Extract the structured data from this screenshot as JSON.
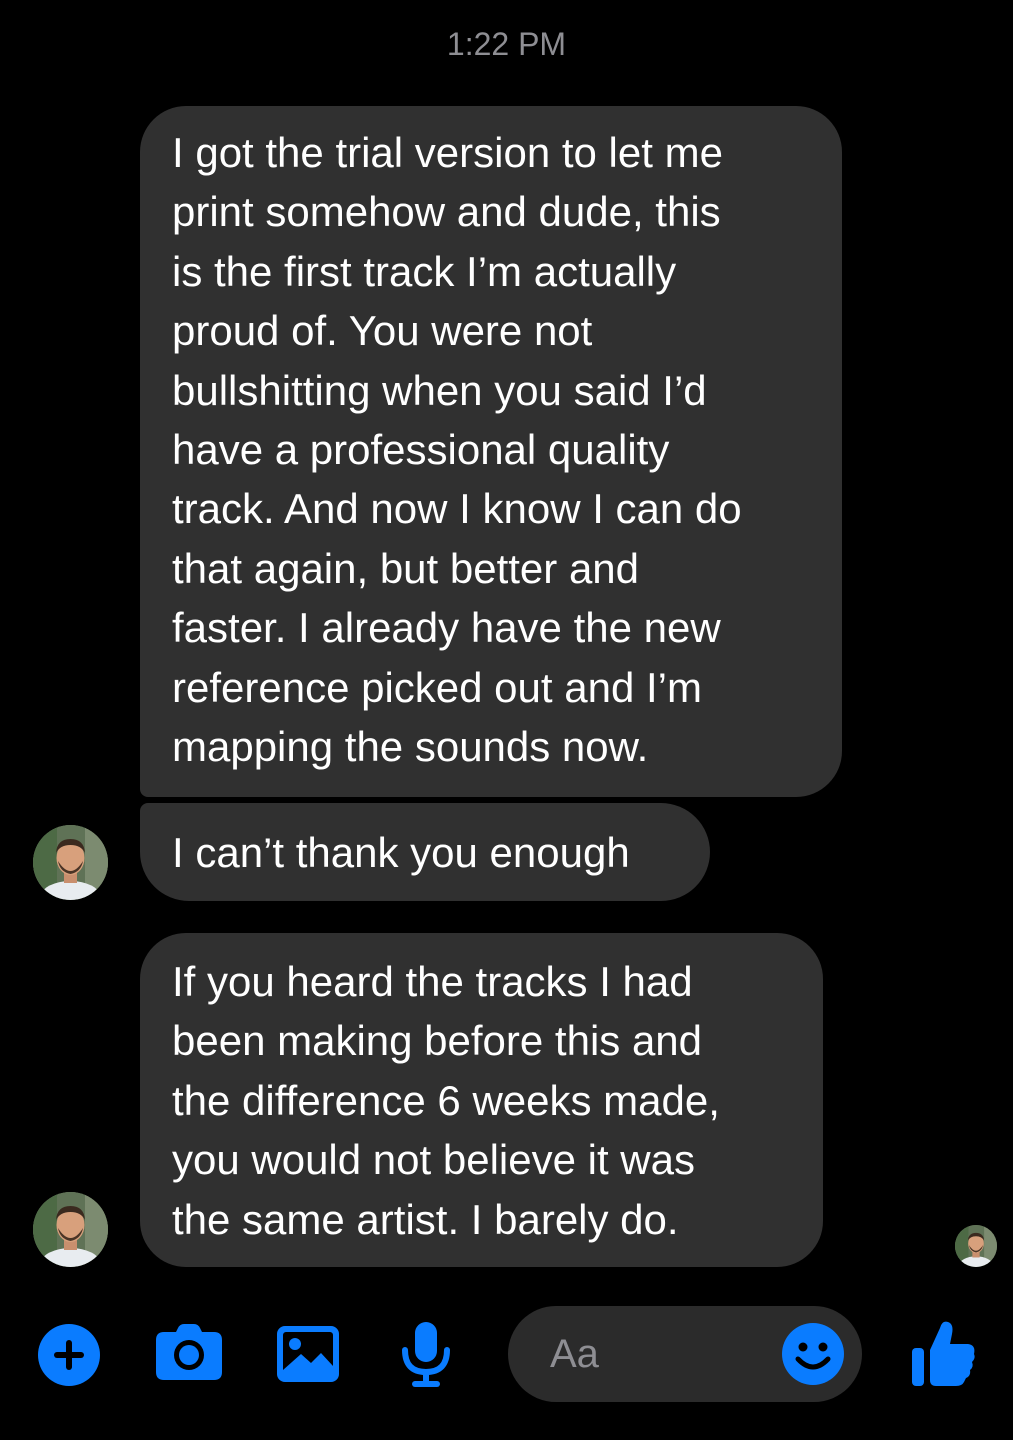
{
  "status": {
    "time": "1:22 PM"
  },
  "messages": [
    {
      "text": "I got the trial version to let me\nprint somehow and dude, this\nis the first track I’m actually\nproud of. You were not\nbullshitting when you said I’d\nhave a professional quality\ntrack. And now I know I can do\nthat again, but better and\nfaster. I already have the new\nreference picked out and I’m\nmapping the sounds now."
    },
    {
      "text": "I can’t thank you enough"
    },
    {
      "text": "If you heard the tracks I had\nbeen making before this and\nthe difference 6 weeks made,\nyou would not believe it was\nthe same artist. I barely do."
    }
  ],
  "composer": {
    "placeholder": "Aa",
    "icons": [
      "plus-icon",
      "camera-icon",
      "image-icon",
      "microphone-icon",
      "emoji-icon",
      "thumbs-up-icon"
    ],
    "accent_color": "#0a7cff"
  },
  "colors": {
    "background": "#000000",
    "bubble": "#303030",
    "muted_text": "#8e8e93"
  }
}
